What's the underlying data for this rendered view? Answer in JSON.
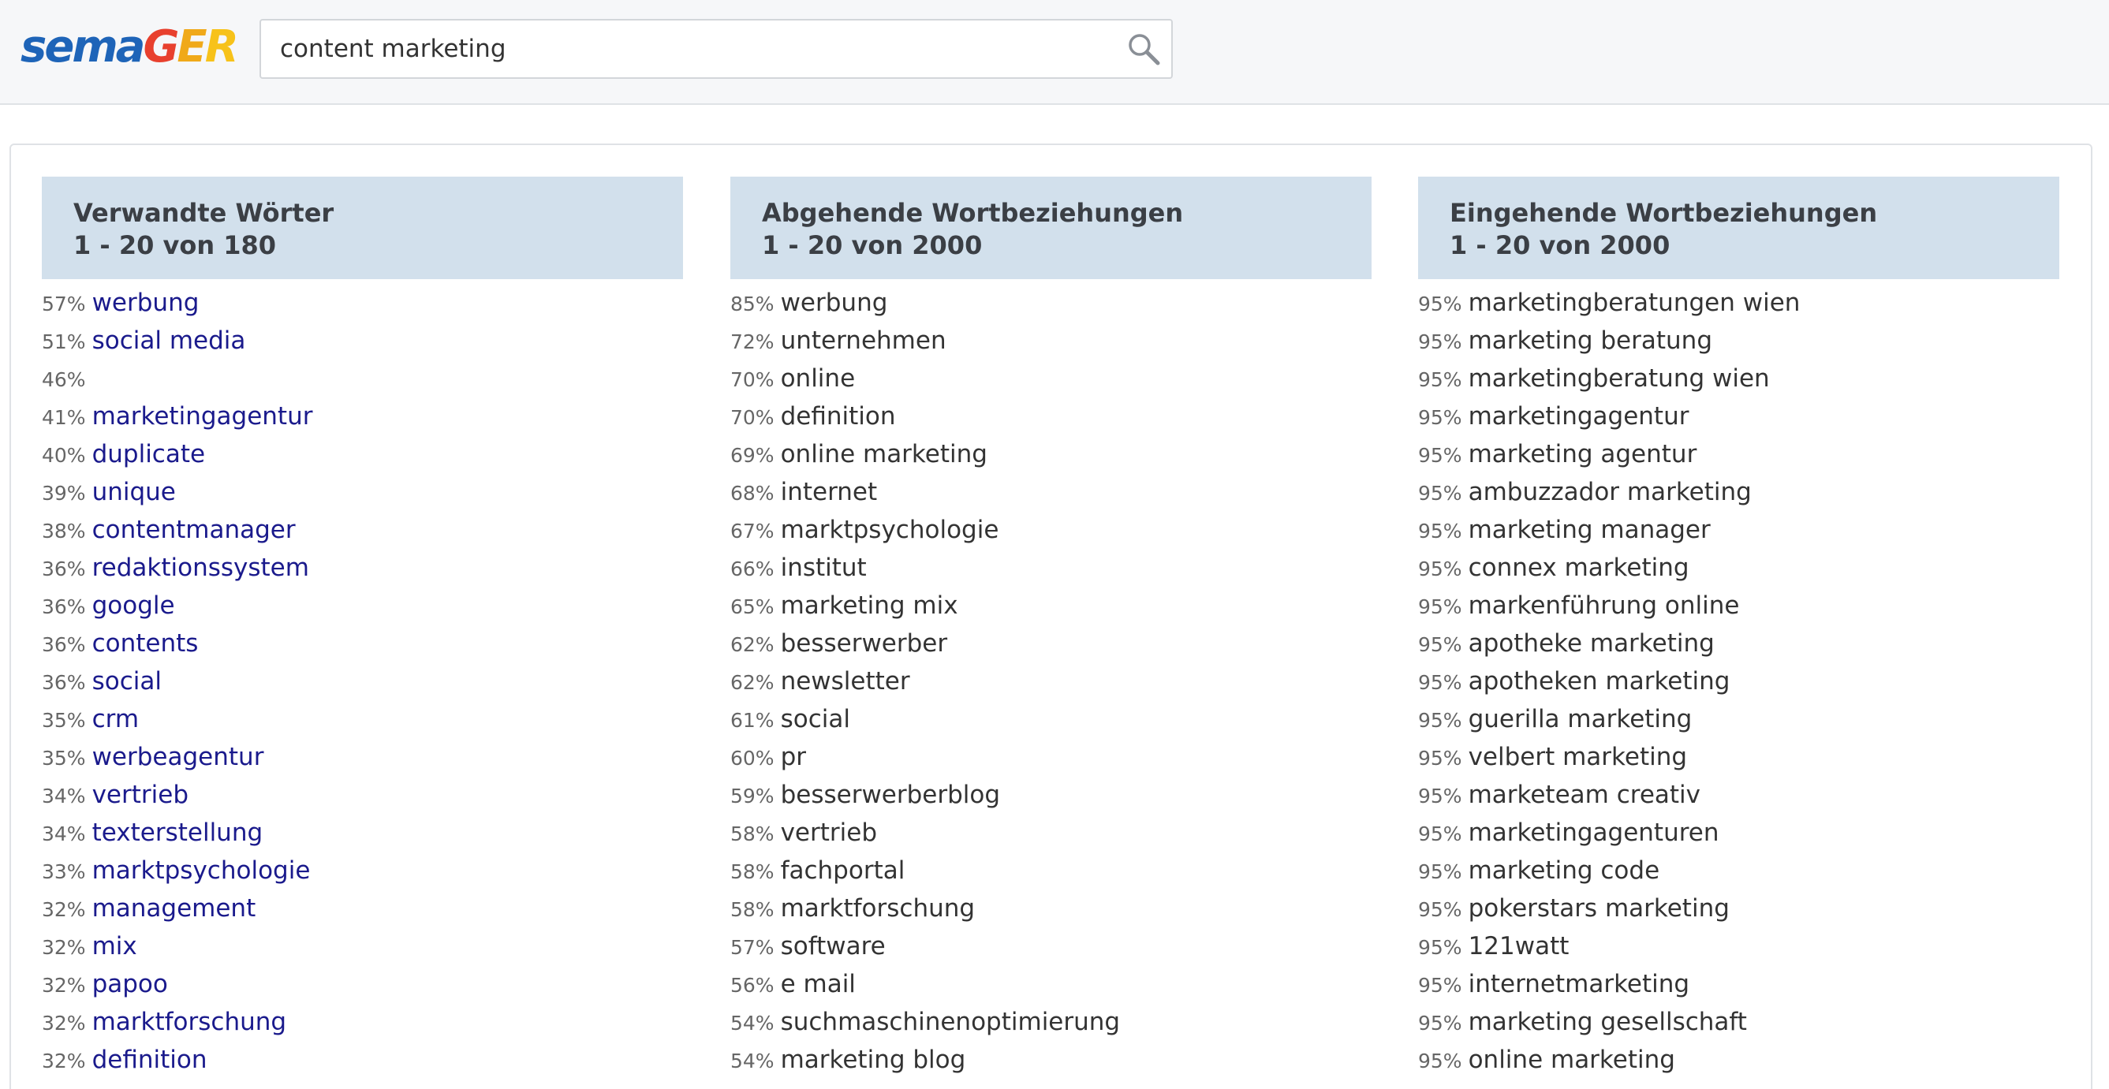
{
  "logo": {
    "part1": "sema",
    "part2_g": "G",
    "part2_e": "E",
    "part2_r": "R"
  },
  "search": {
    "value": "content marketing",
    "icon": "search-icon"
  },
  "columns": [
    {
      "title": "Verwandte Wörter",
      "range": "1 - 20 von 180",
      "items": [
        {
          "pct": "57%",
          "word": "werbung"
        },
        {
          "pct": "51%",
          "word": "social media"
        },
        {
          "pct": "46%",
          "word": ""
        },
        {
          "pct": "41%",
          "word": "marketingagentur"
        },
        {
          "pct": "40%",
          "word": "duplicate"
        },
        {
          "pct": "39%",
          "word": "unique"
        },
        {
          "pct": "38%",
          "word": "contentmanager"
        },
        {
          "pct": "36%",
          "word": "redaktionssystem"
        },
        {
          "pct": "36%",
          "word": "google"
        },
        {
          "pct": "36%",
          "word": "contents"
        },
        {
          "pct": "36%",
          "word": "social"
        },
        {
          "pct": "35%",
          "word": "crm"
        },
        {
          "pct": "35%",
          "word": "werbeagentur"
        },
        {
          "pct": "34%",
          "word": "vertrieb"
        },
        {
          "pct": "34%",
          "word": "texterstellung"
        },
        {
          "pct": "33%",
          "word": "marktpsychologie"
        },
        {
          "pct": "32%",
          "word": "management"
        },
        {
          "pct": "32%",
          "word": "mix"
        },
        {
          "pct": "32%",
          "word": "papoo"
        },
        {
          "pct": "32%",
          "word": "marktforschung"
        },
        {
          "pct": "32%",
          "word": "definition"
        }
      ]
    },
    {
      "title": "Abgehende Wortbeziehungen",
      "range": "1 - 20 von 2000",
      "items": [
        {
          "pct": "85%",
          "word": "werbung"
        },
        {
          "pct": "72%",
          "word": "unternehmen"
        },
        {
          "pct": "70%",
          "word": "online"
        },
        {
          "pct": "70%",
          "word": "definition"
        },
        {
          "pct": "69%",
          "word": "online marketing"
        },
        {
          "pct": "68%",
          "word": "internet"
        },
        {
          "pct": "67%",
          "word": "marktpsychologie"
        },
        {
          "pct": "66%",
          "word": "institut"
        },
        {
          "pct": "65%",
          "word": "marketing mix"
        },
        {
          "pct": "62%",
          "word": "besserwerber"
        },
        {
          "pct": "62%",
          "word": "newsletter"
        },
        {
          "pct": "61%",
          "word": "social"
        },
        {
          "pct": "60%",
          "word": "pr"
        },
        {
          "pct": "59%",
          "word": "besserwerberblog"
        },
        {
          "pct": "58%",
          "word": "vertrieb"
        },
        {
          "pct": "58%",
          "word": "fachportal"
        },
        {
          "pct": "58%",
          "word": "marktforschung"
        },
        {
          "pct": "57%",
          "word": "software"
        },
        {
          "pct": "56%",
          "word": "e mail"
        },
        {
          "pct": "54%",
          "word": "suchmaschinenoptimierung"
        },
        {
          "pct": "54%",
          "word": "marketing blog"
        }
      ]
    },
    {
      "title": "Eingehende Wortbeziehungen",
      "range": "1 - 20 von 2000",
      "items": [
        {
          "pct": "95%",
          "word": "marketingberatungen wien"
        },
        {
          "pct": "95%",
          "word": "marketing beratung"
        },
        {
          "pct": "95%",
          "word": "marketingberatung wien"
        },
        {
          "pct": "95%",
          "word": "marketingagentur"
        },
        {
          "pct": "95%",
          "word": "marketing agentur"
        },
        {
          "pct": "95%",
          "word": "ambuzzador marketing"
        },
        {
          "pct": "95%",
          "word": "marketing manager"
        },
        {
          "pct": "95%",
          "word": "connex marketing"
        },
        {
          "pct": "95%",
          "word": "markenführung online"
        },
        {
          "pct": "95%",
          "word": "apotheke marketing"
        },
        {
          "pct": "95%",
          "word": "apotheken marketing"
        },
        {
          "pct": "95%",
          "word": "guerilla marketing"
        },
        {
          "pct": "95%",
          "word": "velbert marketing"
        },
        {
          "pct": "95%",
          "word": "marketeam creativ"
        },
        {
          "pct": "95%",
          "word": "marketingagenturen"
        },
        {
          "pct": "95%",
          "word": "marketing code"
        },
        {
          "pct": "95%",
          "word": "pokerstars marketing"
        },
        {
          "pct": "95%",
          "word": "121watt"
        },
        {
          "pct": "95%",
          "word": "internetmarketing"
        },
        {
          "pct": "95%",
          "word": "marketing gesellschaft"
        },
        {
          "pct": "95%",
          "word": "online marketing"
        }
      ]
    }
  ]
}
